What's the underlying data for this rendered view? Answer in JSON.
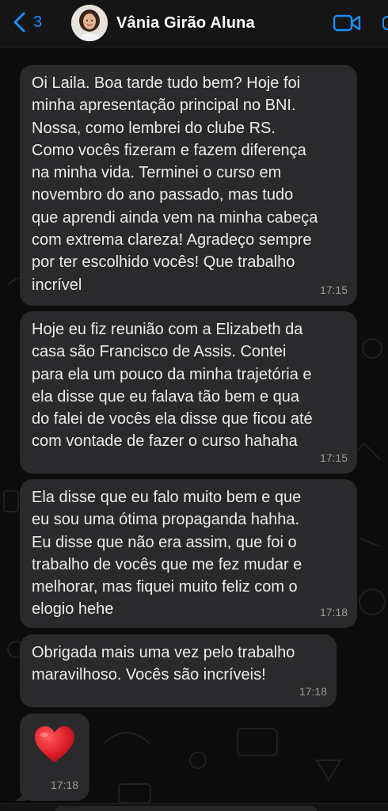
{
  "header": {
    "back_count": "3",
    "contact_name": "Vânia Girão Aluna"
  },
  "messages": [
    {
      "text": "Oi Laila. Boa tarde tudo bem? Hoje foi\nminha apresentação principal no BNI.\nNossa, como lembrei do clube RS.\nComo vocês fizeram e fazem diferença\nna minha vida. Terminei o curso em\nnovembro do ano passado, mas tudo\nque aprendi ainda vem na minha cabeça\ncom extrema clareza! Agradeço sempre\npor ter escolhido vocês! Que trabalho\nincrível",
      "time": "17:15"
    },
    {
      "text": "Hoje eu fiz reunião com a Elizabeth da\ncasa são Francisco de Assis. Contei\npara ela um pouco da minha trajetória e\nela disse que eu falava tão bem e qua\ndo falei de vocês ela disse que ficou até\ncom vontade de fazer o curso hahaha",
      "time": "17:15"
    },
    {
      "text": "Ela disse que eu falo muito bem e que\neu sou uma ótima propaganda hahha.\nEu disse que não era assim, que foi o\ntrabalho de vocês que me fez mudar e\nmelhorar, mas fiquei muito feliz com o\nelogio hehe",
      "time": "17:18"
    },
    {
      "text": "Obrigada mais uma vez pelo trabalho\nmaravilhoso. Vocês são incríveis!",
      "time": "17:18"
    },
    {
      "emoji": "heart",
      "time": "17:18"
    }
  ],
  "colors": {
    "accent": "#1a8fff",
    "bubble": "#2a2a2c",
    "heart": "#e0202a"
  }
}
